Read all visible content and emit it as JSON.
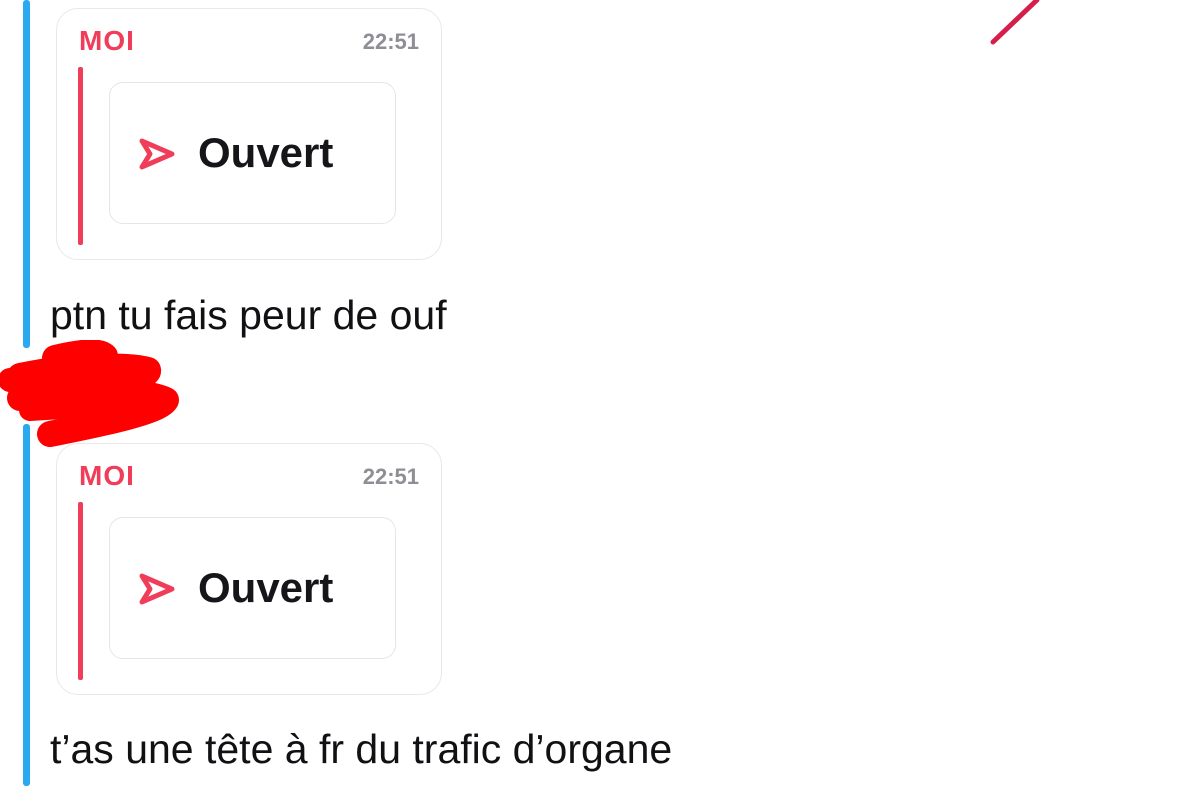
{
  "messages": [
    {
      "quote": {
        "sender": "MOI",
        "time": "22:51",
        "status_label": "Ouvert",
        "status_icon": "sent-arrow-icon"
      },
      "text": "ptn tu fais peur de ouf"
    },
    {
      "quote": {
        "sender": "MOI",
        "time": "22:51",
        "status_label": "Ouvert",
        "status_icon": "sent-arrow-icon"
      },
      "text": "t’as une tête à fr du trafic d’organe"
    }
  ],
  "colors": {
    "thread_bar": "#2aa8f0",
    "accent": "#ef3d5a",
    "redaction": "#ff0000",
    "text": "#111114"
  }
}
